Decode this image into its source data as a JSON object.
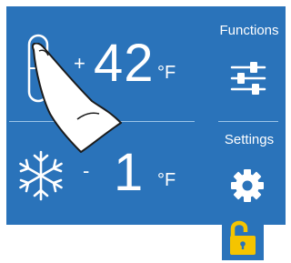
{
  "fridge": {
    "sign": "+",
    "value": "42",
    "unit": "°F"
  },
  "freezer": {
    "sign": "-",
    "value": "1",
    "unit": "°F"
  },
  "sidebar": {
    "functions_label": "Functions",
    "settings_label": "Settings"
  },
  "lock": {
    "state": "unlocked",
    "icon": "unlocked-padlock-icon"
  },
  "colors": {
    "panel": "#2a73ba",
    "text": "#ffffff",
    "lock": "#f5c400"
  }
}
